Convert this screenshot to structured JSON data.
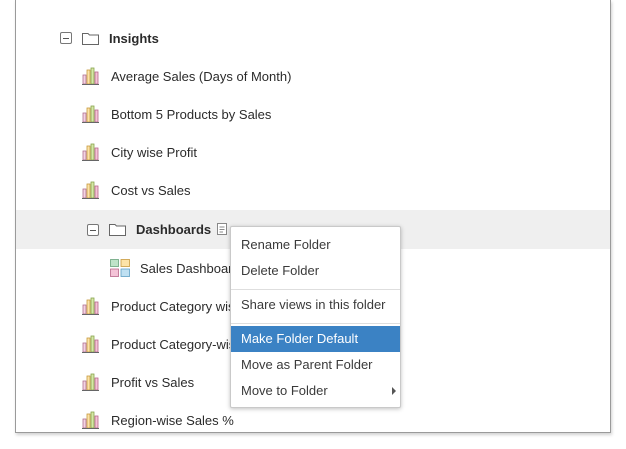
{
  "tree": {
    "root": {
      "label": "Insights"
    },
    "reports": [
      {
        "label": "Average Sales (Days of Month)"
      },
      {
        "label": "Bottom 5 Products by Sales"
      },
      {
        "label": "City wise Profit"
      },
      {
        "label": "Cost vs Sales"
      }
    ],
    "subfolder": {
      "label": "Dashboards",
      "child": "Sales Dashboard"
    },
    "reports_after": [
      {
        "label": "Product Category wise"
      },
      {
        "label": "Product Category-wise"
      },
      {
        "label": "Profit vs Sales"
      },
      {
        "label": "Region-wise Sales %"
      }
    ]
  },
  "context_menu": {
    "items": [
      {
        "label": "Rename Folder"
      },
      {
        "label": "Delete Folder"
      },
      {
        "label": "Share views in this folder"
      },
      {
        "label": "Make Folder Default"
      },
      {
        "label": "Move as Parent Folder"
      },
      {
        "label": "Move to Folder"
      }
    ]
  },
  "colors": {
    "highlight": "#efefef",
    "menu_active": "#3b82c4"
  },
  "icons": [
    "collapse-icon",
    "folder-icon",
    "chart-icon",
    "dashboard-icon",
    "note-icon",
    "submenu-arrow-icon"
  ]
}
